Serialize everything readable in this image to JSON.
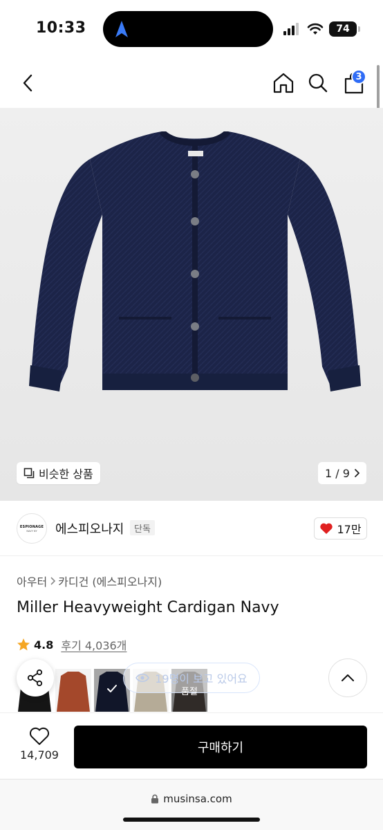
{
  "status_bar": {
    "time": "10:33",
    "battery": "74"
  },
  "header": {
    "cart_count": "3"
  },
  "gallery": {
    "similar_label": "비슷한 상품",
    "page_indicator": "1 / 9"
  },
  "brand": {
    "logo_line1": "ESPIONAGE",
    "logo_line2": "NAVY NY",
    "name": "에스피오나지",
    "badge": "단독",
    "likes": "17만"
  },
  "breadcrumb": {
    "category": "아우터",
    "subcategory": "카디건 (에스피오나지)"
  },
  "product": {
    "title": "Miller Heavyweight Cardigan Navy",
    "rating": "4.8",
    "reviews": "후기 4,036개",
    "viewers": "19명이 보고 있어요"
  },
  "swatches": [
    {
      "color": "#151515"
    },
    {
      "color": "#a4482b"
    },
    {
      "color": "#1b2240",
      "selected": true
    },
    {
      "color": "#b5ab97"
    },
    {
      "color": "#3a3028",
      "soldout_label": "품절"
    }
  ],
  "bottom": {
    "wish_count": "14,709",
    "buy_label": "구매하기"
  },
  "browser": {
    "url": "musinsa.com"
  },
  "colors": {
    "accent_blue": "#2f6cf6",
    "navy": "#1c2448",
    "heart_red": "#e02020",
    "star": "#f5a623"
  }
}
